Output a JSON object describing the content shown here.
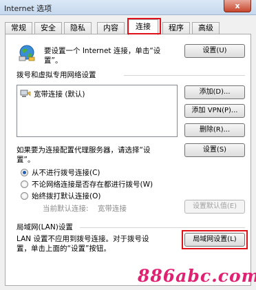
{
  "window": {
    "title": "Internet 选项",
    "close_label": "x"
  },
  "tabs": [
    {
      "label": "常规"
    },
    {
      "label": "安全"
    },
    {
      "label": "隐私"
    },
    {
      "label": "内容"
    },
    {
      "label": "连接",
      "active": true
    },
    {
      "label": "程序"
    },
    {
      "label": "高级"
    }
  ],
  "setup": {
    "text": "要设置一个 Internet 连接，单击“设置”。",
    "text_line1": "要设置一个 Internet 连接，单击“设",
    "text_line2": "置”。",
    "button": "设置(U)",
    "icon": "globe-network-icon"
  },
  "dialup": {
    "heading": "拨号和虚拟专用网络设置",
    "connections": [
      {
        "name": "宽带连接 (默认)",
        "icon": "broadband-connection-icon"
      }
    ],
    "add_button": "添加(D)...",
    "add_vpn_button": "添加 VPN(P)...",
    "delete_button": "删除(R)...",
    "proxy_text": "如果要为连接配置代理服务器，请选择“设置”。",
    "proxy_line1": "如果要为连接配置代理服务器，请选择“设",
    "proxy_line2": "置”。",
    "settings_button": "设置(S)",
    "options": [
      {
        "label": "从不进行拨号连接(C)",
        "checked": true
      },
      {
        "label": "不论网络连接是否存在都进行拨号(W)",
        "checked": false
      },
      {
        "label": "始终拨打默认连接(O)",
        "checked": false
      }
    ],
    "current_default_label": "当前默认连接:",
    "current_default_value": "宽带连接",
    "set_default_button": "设置默认值(E)"
  },
  "lan": {
    "heading": "局域网(LAN)设置",
    "description": "LAN 设置不应用到拨号连接。对于拨号设置，单击上面的“设置”按钮。",
    "desc_line1": "LAN 设置不应用到拨号连接。对于拨号设",
    "desc_line2": "置，单击上面的“设置”按钮。",
    "button": "局域网设置(L)"
  },
  "watermark": "886abc.com",
  "colors": {
    "highlight": "#e0101a",
    "watermark": "#e02070",
    "radio_selected": "#1d5fb8"
  }
}
